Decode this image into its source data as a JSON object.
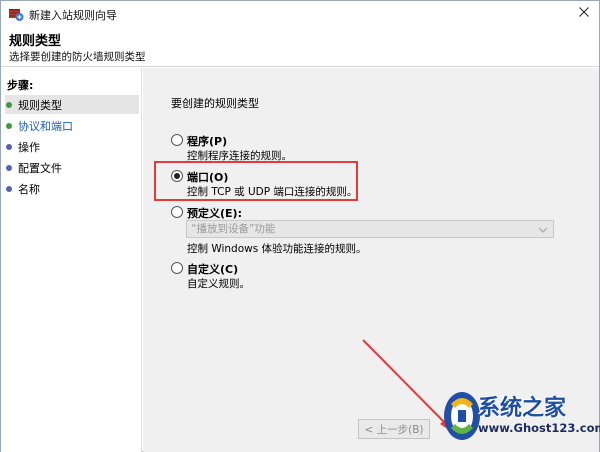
{
  "window": {
    "title": "新建入站规则向导"
  },
  "header": {
    "title": "规则类型",
    "subtitle": "选择要创建的防火墙规则类型"
  },
  "steps": {
    "label": "步骤:",
    "items": [
      {
        "label": "规则类型",
        "color": "#3f9a3f"
      },
      {
        "label": "协议和端口",
        "color": "#3f9a3f"
      },
      {
        "label": "操作",
        "color": "#5560b8"
      },
      {
        "label": "配置文件",
        "color": "#5560b8"
      },
      {
        "label": "名称",
        "color": "#5560b8"
      }
    ]
  },
  "main": {
    "question": "要创建的规则类型",
    "options": [
      {
        "label": "程序(P)",
        "desc": "控制程序连接的规则。",
        "checked": false
      },
      {
        "label": "端口(O)",
        "desc": "控制 TCP 或 UDP 端口连接的规则。",
        "checked": true
      },
      {
        "label": "预定义(E):",
        "desc": "控制 Windows 体验功能连接的规则。",
        "checked": false
      },
      {
        "label": "自定义(C)",
        "desc": "自定义规则。",
        "checked": false
      }
    ],
    "predefined_select": "“播放到设备”功能",
    "back_button": "< 上一步(B)"
  },
  "watermark": {
    "name": "系统之家",
    "url": "www.Ghost123.com"
  },
  "colors": {
    "highlight": "#e5393c",
    "link": "#1a5fb4"
  }
}
